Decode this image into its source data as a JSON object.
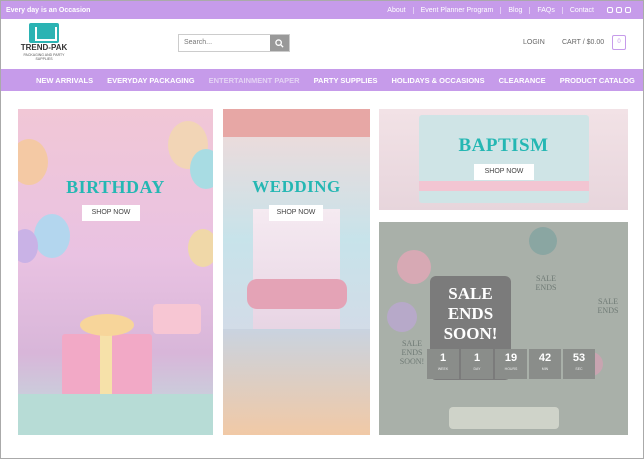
{
  "topbar": {
    "tagline": "Every day is an Occasion",
    "links": [
      "About",
      "Event Planner Program",
      "Blog",
      "FAQs",
      "Contact"
    ]
  },
  "header": {
    "logo_name": "TREND-PAK",
    "logo_sub": "PACKAGING AND PARTY SUPPLIES",
    "search_placeholder": "Search...",
    "login_label": "LOGIN",
    "cart_label": "CART / $0.00",
    "cart_count": "0"
  },
  "nav": {
    "items": [
      "NEW ARRIVALS",
      "EVERYDAY PACKAGING",
      "ENTERTAINMENT PAPER",
      "PARTY SUPPLIES",
      "HOLIDAYS & OCCASIONS",
      "CLEARANCE",
      "PRODUCT CATALOG"
    ]
  },
  "cards": {
    "birthday": {
      "title": "BIRTHDAY",
      "button": "SHOP NOW"
    },
    "wedding": {
      "title": "WEDDING",
      "button": "SHOP NOW"
    },
    "baptism": {
      "title": "BAPTISM",
      "button": "SHOP NOW"
    },
    "sale": {
      "title": "SALE ENDS SOON!",
      "side_left": "SALE ENDS SOON!",
      "side_top": "SALE ENDS",
      "side_right": "SALE ENDS",
      "countdown": [
        {
          "value": "1",
          "label": "WEEK"
        },
        {
          "value": "1",
          "label": "DAY"
        },
        {
          "value": "19",
          "label": "HOURS"
        },
        {
          "value": "42",
          "label": "MIN"
        },
        {
          "value": "53",
          "label": "SEC"
        }
      ]
    }
  },
  "colors": {
    "accent": "#c69bea",
    "teal": "#25b7b3"
  },
  "icons": [
    "search-icon",
    "facebook-icon",
    "instagram-icon",
    "email-icon",
    "cart-icon"
  ]
}
